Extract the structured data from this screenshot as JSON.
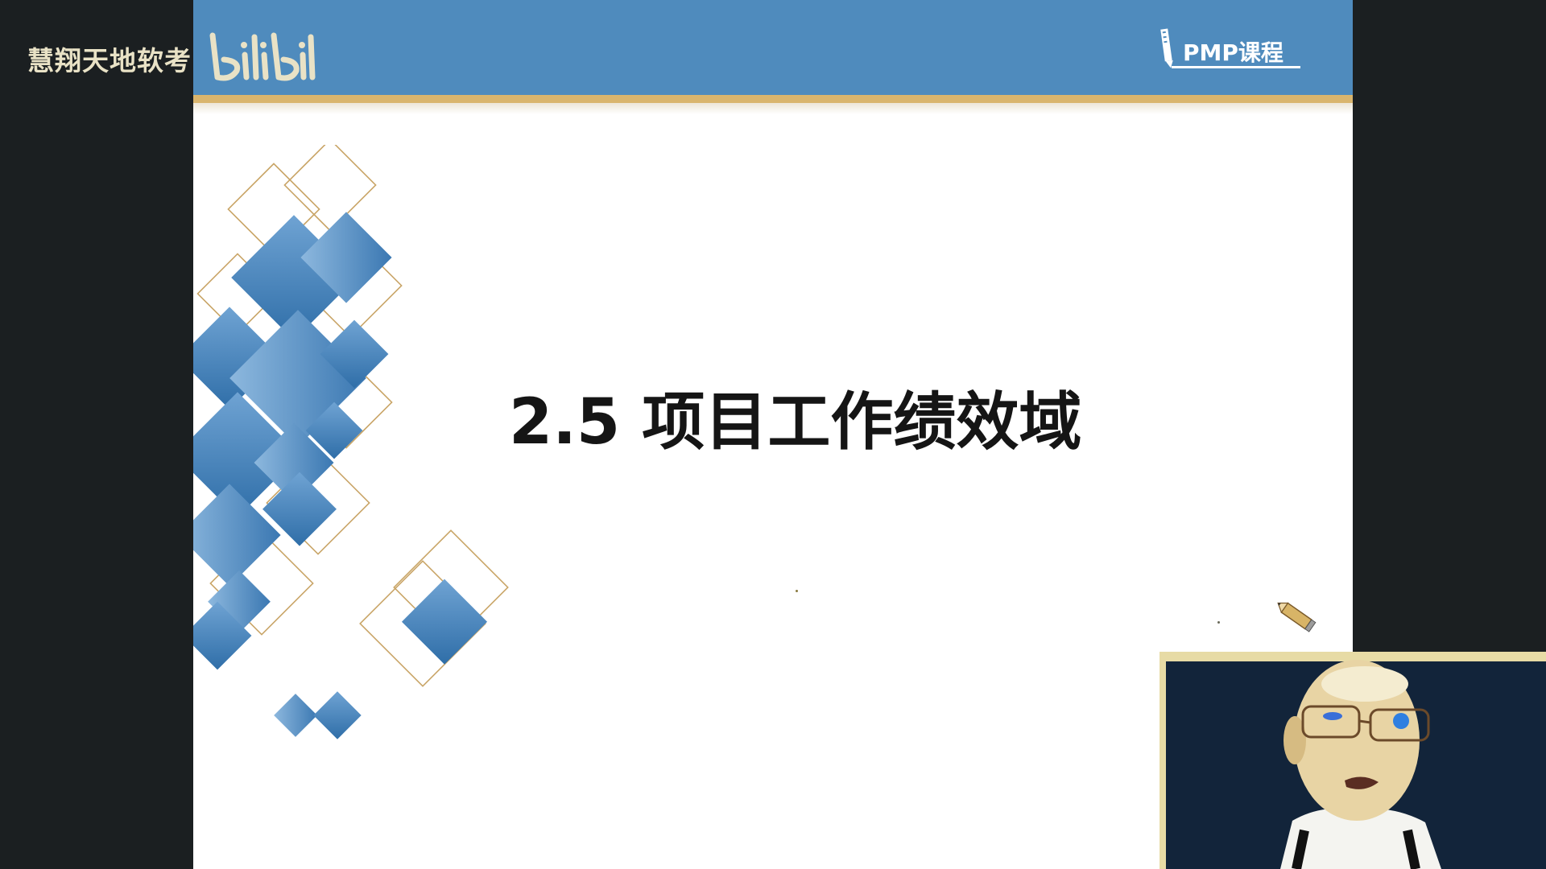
{
  "watermark": {
    "channel_name": "慧翔天地软考",
    "platform_logo": "bilibili",
    "logo_color": "#e9e2c6"
  },
  "header": {
    "course_label": "PMP课程",
    "band_color": "#4f8bbd",
    "stripe_color": "#d9b56e",
    "icon": "pen-icon"
  },
  "slide": {
    "title": "2.5 项目工作绩效域",
    "decoration": "blue-diamond-pattern",
    "accent_colors": [
      "#3f7fb9",
      "#c9a567"
    ],
    "pointer_icon": "pencil-icon"
  },
  "webcam": {
    "present": true,
    "frame_color": "#e7dba5"
  }
}
